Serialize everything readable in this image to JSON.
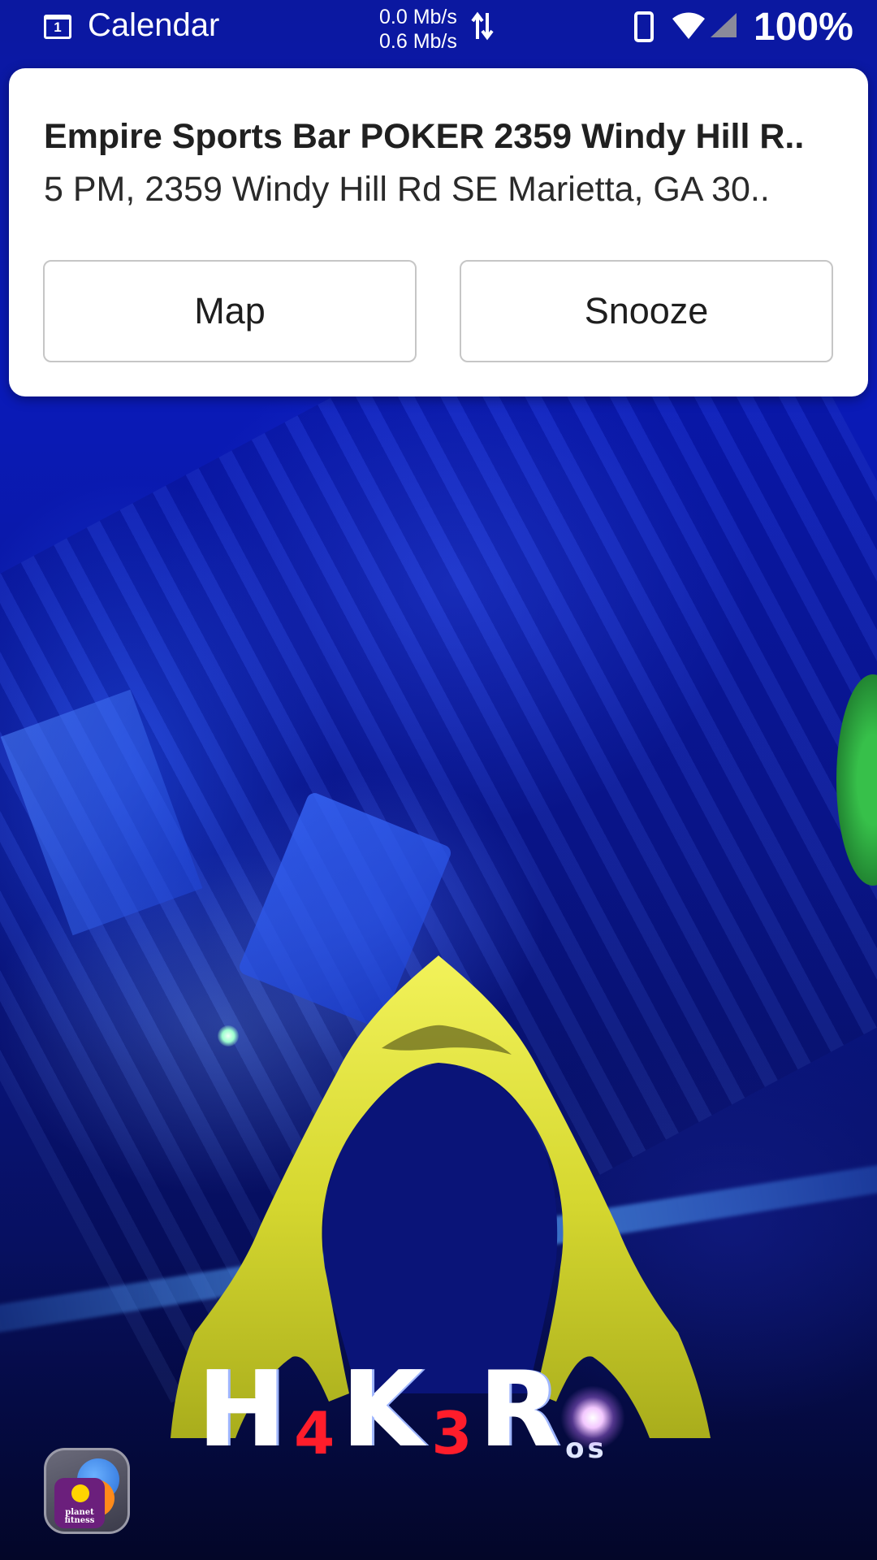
{
  "status_bar": {
    "app_name": "Calendar",
    "calendar_icon_day": "1",
    "net_down": "0.0 Mb/s",
    "net_up": "0.6 Mb/s",
    "battery": "100%"
  },
  "notification": {
    "title": "Empire Sports Bar POKER 2359 Windy Hill R..",
    "text": "5 PM, 2359 Windy Hill Rd SE Marietta, GA 30..",
    "actions": {
      "map": "Map",
      "snooze": "Snooze"
    }
  },
  "wallpaper": {
    "logo_parts": [
      "H",
      "4",
      "K",
      "3",
      "R",
      "os"
    ]
  },
  "app_bubble": {
    "label": "planet fitness"
  },
  "colors": {
    "wallpaper_blue": "#0a1ab8",
    "hood_yellow": "#e4e63a",
    "logo_red": "#ff1d2b",
    "card_bg": "#ffffff"
  }
}
